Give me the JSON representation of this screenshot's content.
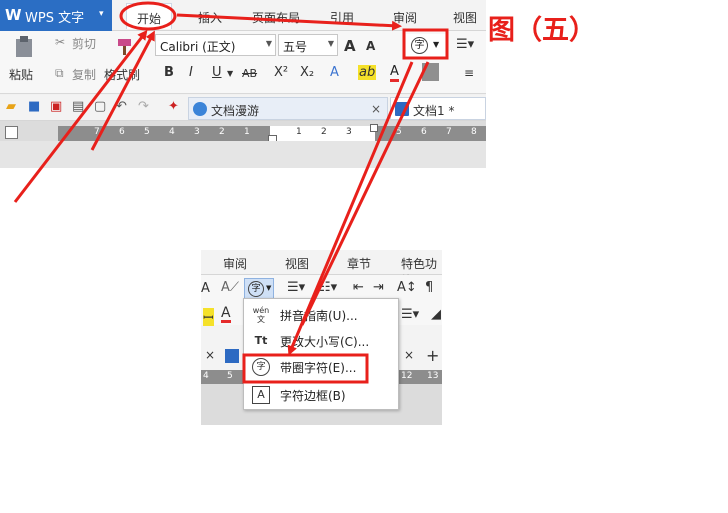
{
  "figure_title": "图（五）",
  "app": {
    "logo": "W",
    "name": "WPS 文字",
    "dropdown": "▾"
  },
  "tabs": {
    "home": "开始",
    "insert": "插入",
    "layout": "页面布局",
    "references": "引用",
    "review": "审阅",
    "view": "视图"
  },
  "ribbon": {
    "paste": "粘贴",
    "cut": "剪切",
    "copy": "复制",
    "format_painter": "格式刷",
    "font_name": "Calibri (正文)",
    "font_size": "五号",
    "grow_font": "A",
    "shrink_font": "A",
    "enclose_char_glyph": "字",
    "bold": "B",
    "italic": "I",
    "underline": "U",
    "strikethrough": "AB",
    "superscript": "X²",
    "subscript": "X₂",
    "text_effect": "A",
    "highlight": "ab",
    "font_color": "A"
  },
  "doc_tabs": {
    "roaming": "文档漫游",
    "doc1": "文档1 *",
    "close": "×"
  },
  "ruler_numbers_top": [
    "7",
    "6",
    "5",
    "4",
    "3",
    "2",
    "1",
    "1",
    "2",
    "3",
    "4",
    "5",
    "6",
    "7",
    "8"
  ],
  "bottom": {
    "tabs": [
      "审阅",
      "视图",
      "章节",
      "特色功能"
    ],
    "close": "×",
    "plus": "+",
    "ruler_numbers": [
      "4",
      "5",
      "12",
      "13"
    ]
  },
  "menu": [
    {
      "label": "拼音指南(U)...",
      "icon": "wén 文"
    },
    {
      "label": "更改大小写(C)...",
      "icon": "Tt"
    },
    {
      "label": "带圈字符(E)...",
      "icon": "字"
    },
    {
      "label": "字符边框(B)",
      "icon": "A"
    }
  ],
  "colors": {
    "annotation_red": "#e8201b",
    "wps_blue": "#2b6ec4"
  }
}
